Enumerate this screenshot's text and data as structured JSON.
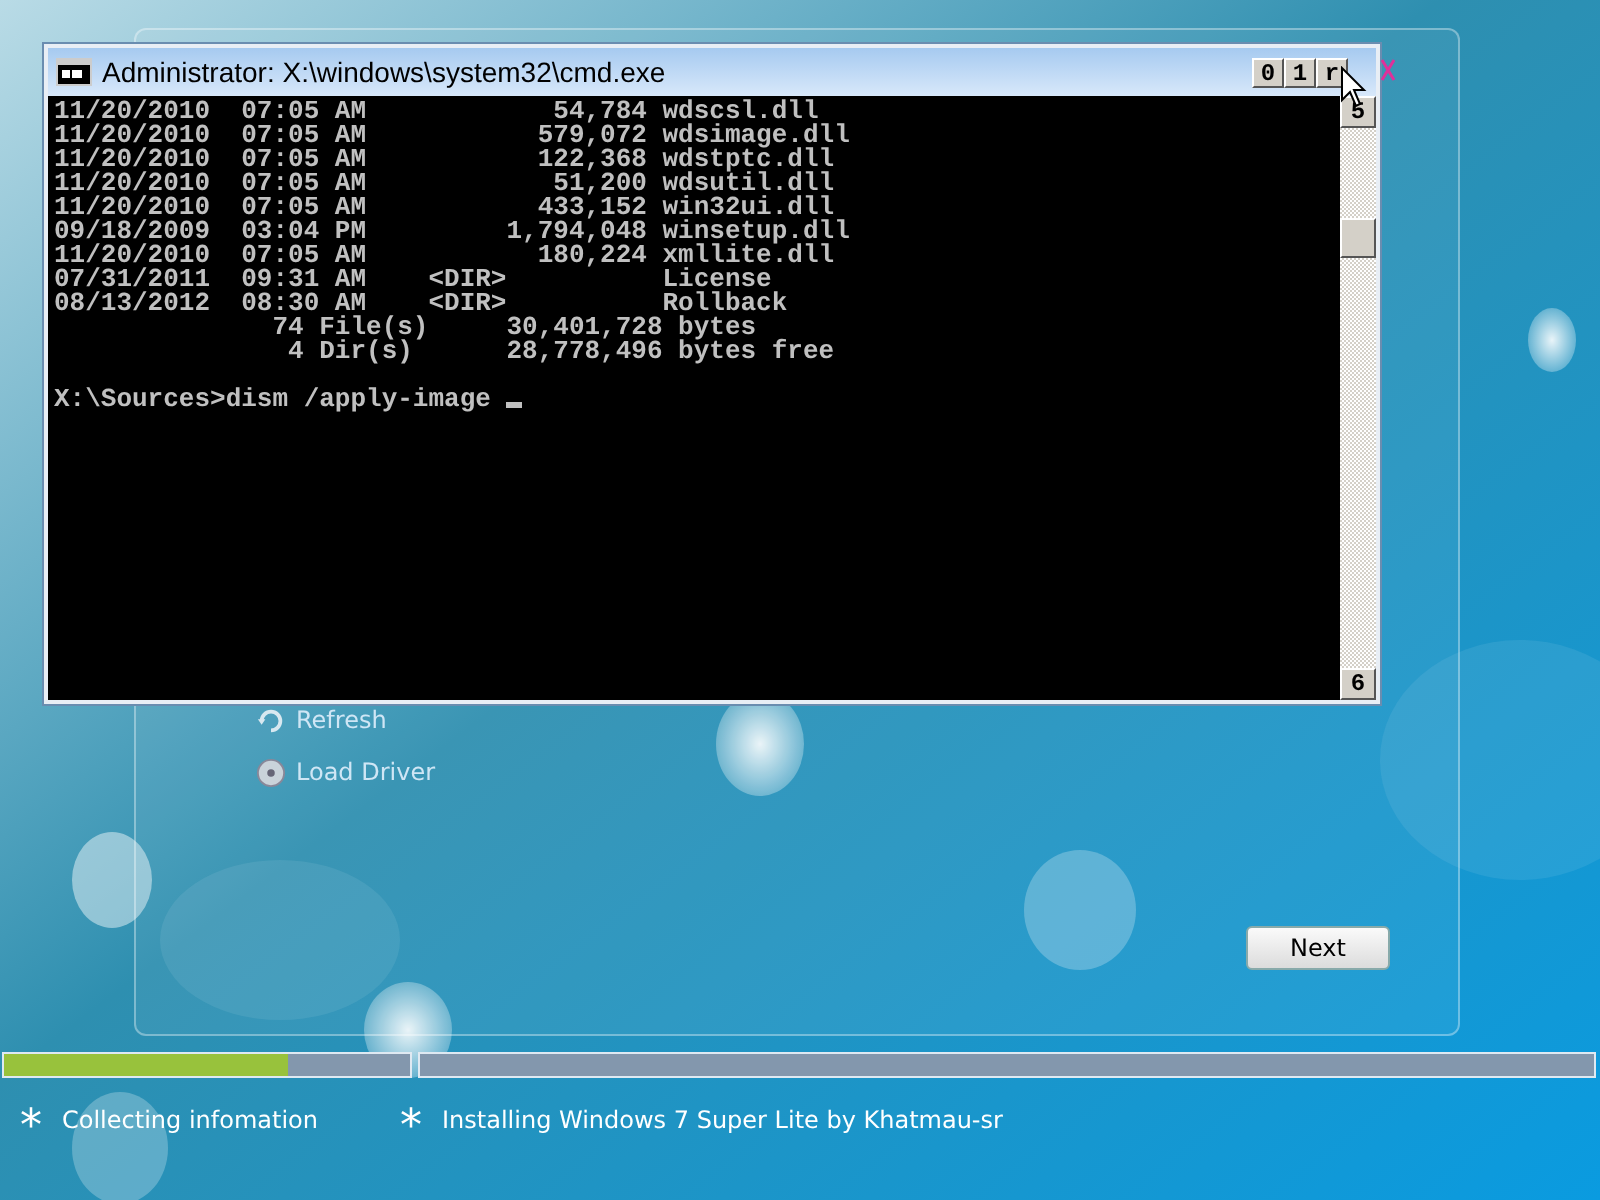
{
  "console": {
    "title": "Administrator: X:\\windows\\system32\\cmd.exe",
    "title_buttons": [
      "0",
      "1",
      "r"
    ],
    "lines": [
      "11/20/2010  07:05 AM            54,784 wdscsl.dll",
      "11/20/2010  07:05 AM           579,072 wdsimage.dll",
      "11/20/2010  07:05 AM           122,368 wdstptc.dll",
      "11/20/2010  07:05 AM            51,200 wdsutil.dll",
      "11/20/2010  07:05 AM           433,152 win32ui.dll",
      "09/18/2009  03:04 PM         1,794,048 winsetup.dll",
      "11/20/2010  07:05 AM           180,224 xmllite.dll",
      "07/31/2011  09:31 AM    <DIR>          License",
      "08/13/2012  08:30 AM    <DIR>          Rollback",
      "              74 File(s)     30,401,728 bytes",
      "               4 Dir(s)      28,778,496 bytes free"
    ],
    "prompt": "X:\\Sources>dism /apply-image ",
    "scroll_up": "5",
    "scroll_down": "6"
  },
  "setup": {
    "links": [
      {
        "label": "Refresh"
      },
      {
        "label": "Load Driver"
      }
    ],
    "next_button": "Next"
  },
  "progress": [
    {
      "level": 0.7
    },
    {
      "level": 0
    }
  ],
  "steps": [
    {
      "marker": "*",
      "label": "Collecting infomation"
    },
    {
      "marker": "*",
      "label": "Installing Windows 7 Super Lite by Khatmau-sr"
    }
  ]
}
